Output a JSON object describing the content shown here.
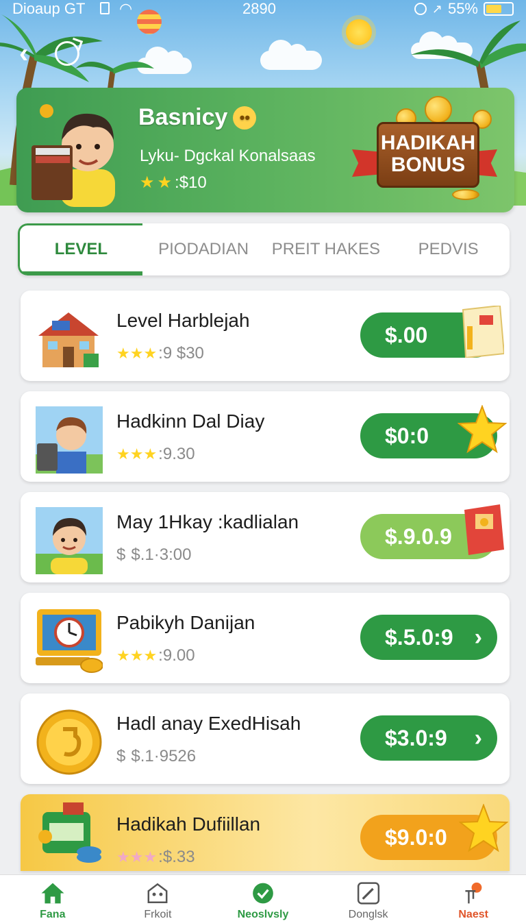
{
  "status_bar": {
    "carrier": "Dioaup GT",
    "time": "2890",
    "battery": "55%"
  },
  "profile": {
    "name": "Basnicy",
    "subtitle": "Lyku- Dgckal Konalsaas",
    "rating_value": ":$10",
    "stars": 2
  },
  "bonus_badge": {
    "line1": "HADIKAH",
    "line2": "BONUS"
  },
  "tabs": [
    {
      "label": "LEVEL",
      "active": true
    },
    {
      "label": "PIODADIAN",
      "active": false
    },
    {
      "label": "PREIT HAKES",
      "active": false
    },
    {
      "label": "PEDVIS",
      "active": false
    }
  ],
  "items": [
    {
      "title": "Level Harblejah",
      "meta": ":9 $30",
      "meta_type": "stars",
      "price": "$.00",
      "thumb_icon": "house-icon",
      "deco_icon": "gift-card-icon"
    },
    {
      "title": "Hadkinn Dal Diay",
      "meta": ":9.30",
      "meta_type": "stars",
      "price": "$0:0",
      "thumb_icon": "boy-laptop-icon",
      "deco_icon": "star-icon"
    },
    {
      "title": "May 1Hkay :kadlialan",
      "meta": "$.1·3:00",
      "meta_type": "dollar",
      "price": "$.9.0.9",
      "thumb_icon": "boy-avatar-icon",
      "deco_icon": "red-envelope-icon"
    },
    {
      "title": "Pabikyh Danijan",
      "meta": ":9.00",
      "meta_type": "stars",
      "price": "$.5.0:9",
      "thumb_icon": "clock-laptop-icon",
      "deco_icon": "chevron-right-icon"
    },
    {
      "title": "Hadl anay ExedHisah",
      "meta": "$.1·9526",
      "meta_type": "dollar",
      "price": "$3.0:9",
      "thumb_icon": "gold-coin-icon",
      "deco_icon": "chevron-right-icon"
    },
    {
      "title": "Hadikah Dufiillan",
      "meta": ":$.33",
      "meta_type": "stars",
      "price": "$9.0:0",
      "thumb_icon": "money-stack-icon",
      "deco_icon": "star-icon"
    }
  ],
  "bottom_nav": [
    {
      "label": "Fana",
      "icon": "home-icon",
      "active": true
    },
    {
      "label": "Frkoit",
      "icon": "bag-icon",
      "active": false
    },
    {
      "label": "Neoslvsly",
      "icon": "check-circle-icon",
      "active": false
    },
    {
      "label": "Donglsk",
      "icon": "edit-icon",
      "active": false
    },
    {
      "label": "Naest",
      "icon": "pin-icon",
      "active": false
    }
  ],
  "colors": {
    "primary_green": "#2e9a44",
    "accent_orange": "#f2a21c",
    "tab_active": "#2f8a3e"
  }
}
